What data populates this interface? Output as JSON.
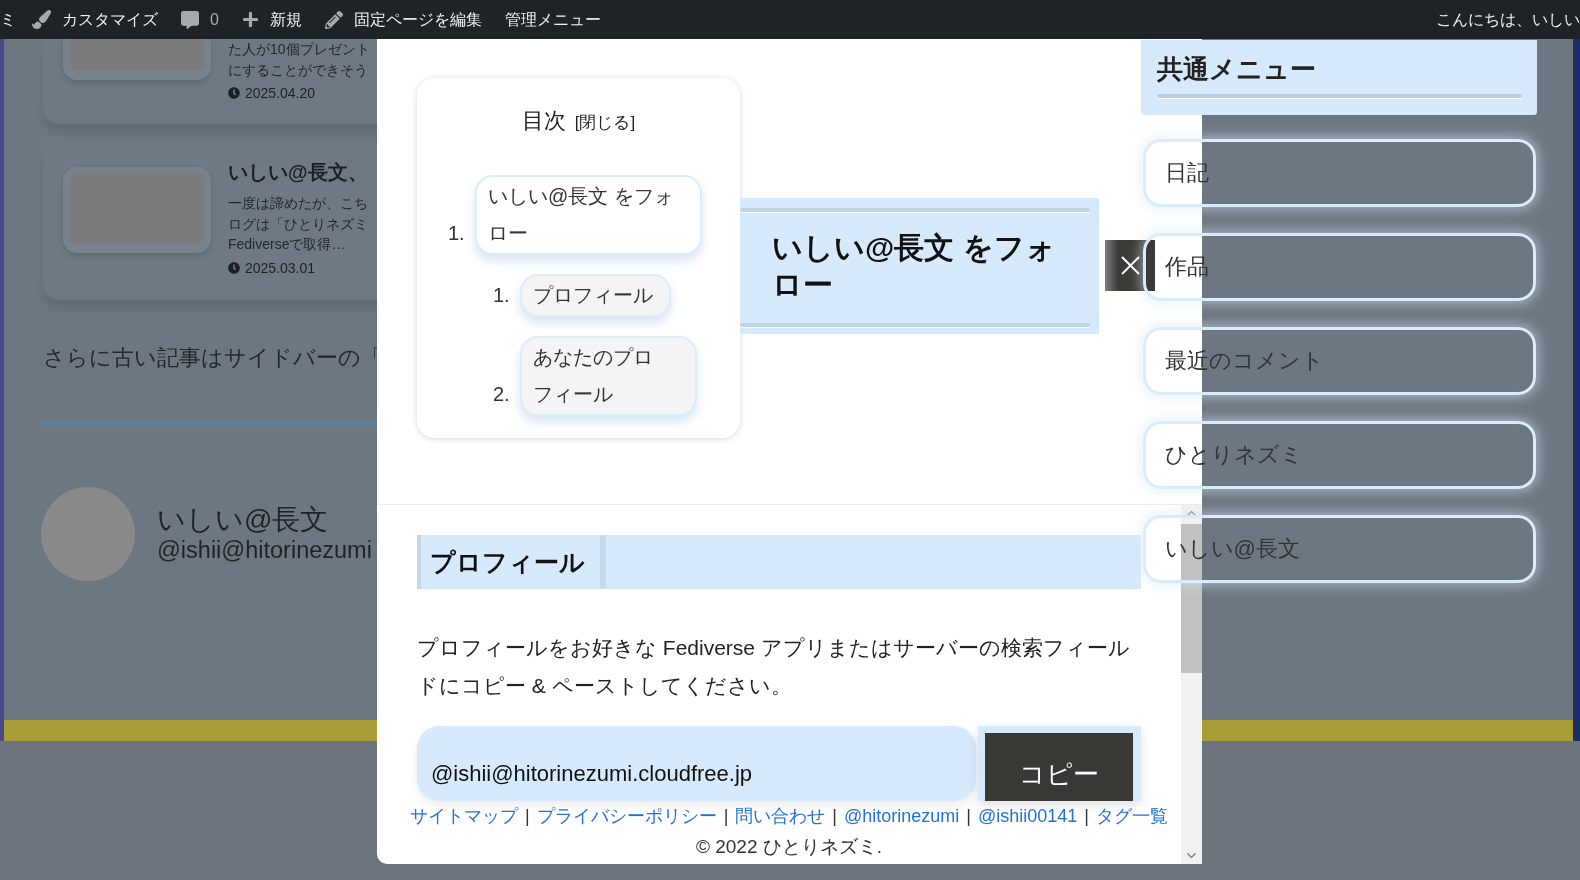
{
  "admin_bar": {
    "site_name": "ミ",
    "items": [
      {
        "kind": "customize",
        "label": "カスタマイズ"
      },
      {
        "kind": "comments",
        "label": "0"
      },
      {
        "kind": "new",
        "label": "新規"
      },
      {
        "kind": "edit",
        "label": "固定ページを編集"
      },
      {
        "kind": "menu",
        "label": "管理メニュー"
      }
    ],
    "greeting": "こんにちは、いしい"
  },
  "background_page": {
    "posts": [
      {
        "excerpt": [
          "た人が10個プレゼント",
          "にすることができそう"
        ],
        "date": "2025.04.20"
      },
      {
        "title": "いしい@長文、",
        "excerpt": [
          "一度は諦めたが、こち",
          "ログは「ひとりネズミ",
          "Fediverseで取得…"
        ],
        "date": "2025.03.01"
      }
    ],
    "note": "さらに古い記事はサイドバーの「",
    "author": {
      "name": "いしい@長文",
      "handle": "@ishii@hitorinezumi"
    }
  },
  "modal": {
    "toc": {
      "title": "目次",
      "toggle": "[閉じる]",
      "items": [
        {
          "number": "1.",
          "label": "いしい@長文 をフォロー",
          "children": [
            {
              "number": "1.",
              "label": "プロフィール"
            },
            {
              "number": "2.",
              "label": "あなたのプロフィール"
            }
          ]
        }
      ]
    },
    "heading": "いしい@長文 をフォロー",
    "section": {
      "title": "プロフィール",
      "description": "プロフィールをお好きな Fediverse アプリまたはサーバーの検索フィールドにコピー & ペーストしてください。",
      "field_value": "@ishii@hitorinezumi.cloudfree.jp",
      "button": "コピー"
    },
    "footer": {
      "links": [
        "サイトマップ",
        "プライバシーポリシー",
        "問い合わせ",
        "@hitorinezumi",
        "@ishii00141",
        "タグ一覧"
      ],
      "separator": "|",
      "copyright": "© 2022 ひとりネズミ."
    }
  },
  "sidebar": {
    "title": "共通メニュー",
    "items": [
      "日記",
      "作品",
      "最近のコメント",
      "ひとりネズミ",
      "いしい@長文"
    ]
  }
}
